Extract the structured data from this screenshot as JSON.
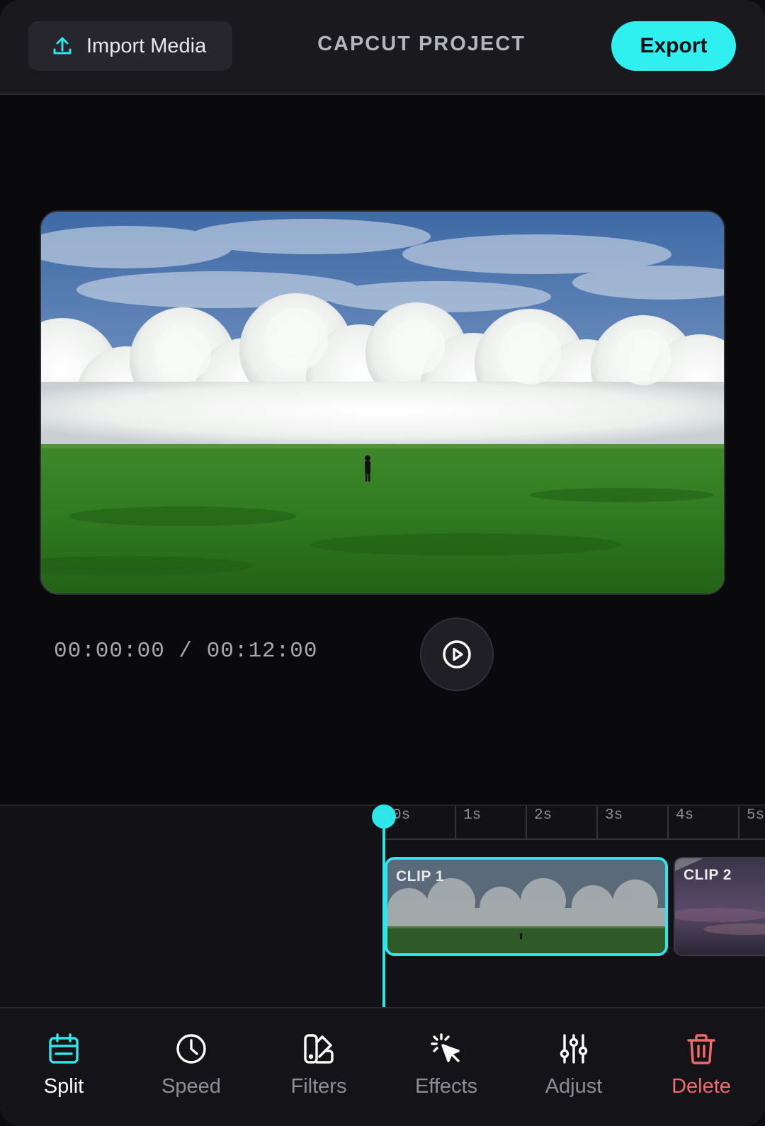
{
  "header": {
    "import_label": "Import Media",
    "project_title": "CAPCUT PROJECT",
    "export_label": "Export"
  },
  "player": {
    "timecode": "00:00:00 / 00:12:00"
  },
  "timeline": {
    "ticks": [
      "0s",
      "1s",
      "2s",
      "3s",
      "4s",
      "5s"
    ],
    "clips": [
      {
        "label": "CLIP 1",
        "selected": true
      },
      {
        "label": "CLIP 2",
        "selected": false
      }
    ]
  },
  "toolbar": {
    "items": [
      {
        "label": "Split",
        "icon": "calendar-split-icon",
        "state": "active"
      },
      {
        "label": "Speed",
        "icon": "clock-icon",
        "state": "normal"
      },
      {
        "label": "Filters",
        "icon": "swatch-icon",
        "state": "normal"
      },
      {
        "label": "Effects",
        "icon": "magic-cursor-icon",
        "state": "normal"
      },
      {
        "label": "Adjust",
        "icon": "sliders-icon",
        "state": "normal"
      },
      {
        "label": "Delete",
        "icon": "trash-icon",
        "state": "danger"
      }
    ]
  },
  "colors": {
    "accent": "#2ff0ef",
    "danger": "#f26b6b",
    "background": "#0a0a0d"
  }
}
